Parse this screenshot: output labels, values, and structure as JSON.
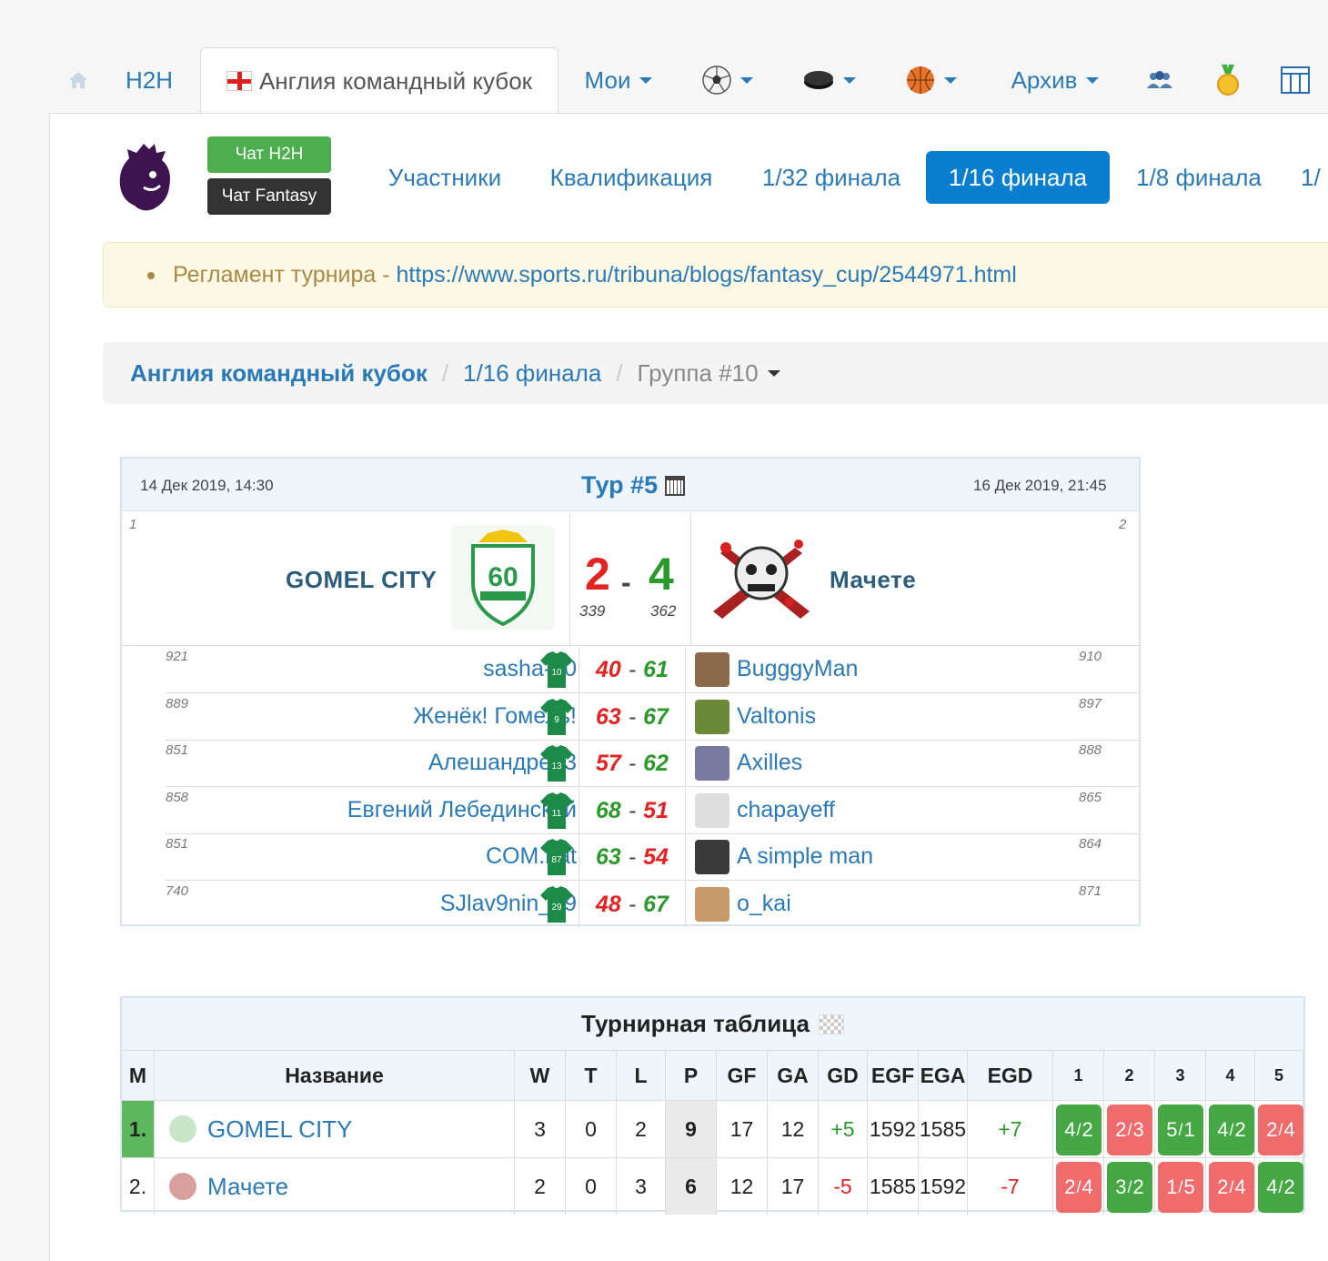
{
  "tabs": {
    "home": "",
    "h2h": "H2H",
    "active": "Англия командный кубок",
    "mine": "Мои",
    "archive": "Архив"
  },
  "chat": {
    "h2h": "Чат H2H",
    "fantasy": "Чат Fantasy"
  },
  "subnav": [
    "Участники",
    "Квалификация",
    "1/32 финала",
    "1/16 финала",
    "1/8 финала",
    "1/"
  ],
  "subnav_active_index": 3,
  "alert": {
    "prefix": "Регламент турнира - ",
    "link": "https://www.sports.ru/tribuna/blogs/fantasy_cup/2544971.html"
  },
  "breadcrumb": {
    "tournament": "Англия командный кубок",
    "round": "1/16 финала",
    "group": "Группа #10",
    "sep": "/"
  },
  "match": {
    "date_start": "14 Дек 2019, 14:30",
    "tour": "Тур #5",
    "date_end": "16 Дек 2019, 21:45",
    "home": {
      "seed": "1",
      "name": "GOMEL CITY",
      "goals": "2",
      "points": "339"
    },
    "away": {
      "seed": "2",
      "name": "Мачете",
      "goals": "4",
      "points": "362"
    },
    "dash": "-",
    "players": [
      {
        "left_rank": "921",
        "left_name": "sasha-10",
        "shirt": "10",
        "ls": "40",
        "rs": "61",
        "right_name": "BugggyMan",
        "right_rank": "910"
      },
      {
        "left_rank": "889",
        "left_name": "Женёк! Гомель!",
        "shirt": "9",
        "ls": "63",
        "rs": "67",
        "right_name": "Valtonis",
        "right_rank": "897"
      },
      {
        "left_rank": "851",
        "left_name": "Алешандре13",
        "shirt": "13",
        "ls": "57",
        "rs": "62",
        "right_name": "Axilles",
        "right_rank": "888"
      },
      {
        "left_rank": "858",
        "left_name": "Евгений Лебединский",
        "shirt": "11",
        "ls": "68",
        "rs": "51",
        "right_name": "chapayeff",
        "right_rank": "865"
      },
      {
        "left_rank": "851",
        "left_name": "COM.bat",
        "shirt": "87",
        "ls": "63",
        "rs": "54",
        "right_name": "A simple man",
        "right_rank": "864"
      },
      {
        "left_rank": "740",
        "left_name": "SJlav9nin_29",
        "shirt": "29",
        "ls": "48",
        "rs": "67",
        "right_name": "o_kai",
        "right_rank": "871"
      }
    ]
  },
  "standings": {
    "title": "Турнирная таблица",
    "headers": [
      "М",
      "Название",
      "W",
      "T",
      "L",
      "P",
      "GF",
      "GA",
      "GD",
      "EGF",
      "EGA",
      "EGD",
      "1",
      "2",
      "3",
      "4",
      "5"
    ],
    "rows": [
      {
        "place": "1.",
        "name": "GOMEL CITY",
        "w": "3",
        "t": "0",
        "l": "2",
        "p": "9",
        "gf": "17",
        "ga": "12",
        "gd": "+5",
        "egf": "1592",
        "ega": "1585",
        "egd": "+7",
        "results": [
          {
            "s": "4",
            "c": "2",
            "win": true
          },
          {
            "s": "2",
            "c": "3",
            "win": false
          },
          {
            "s": "5",
            "c": "1",
            "win": true
          },
          {
            "s": "4",
            "c": "2",
            "win": true
          },
          {
            "s": "2",
            "c": "4",
            "win": false
          }
        ]
      },
      {
        "place": "2.",
        "name": "Мачете",
        "w": "2",
        "t": "0",
        "l": "3",
        "p": "6",
        "gf": "12",
        "ga": "17",
        "gd": "-5",
        "egf": "1585",
        "ega": "1592",
        "egd": "-7",
        "results": [
          {
            "s": "2",
            "c": "4",
            "win": false
          },
          {
            "s": "3",
            "c": "2",
            "win": true
          },
          {
            "s": "1",
            "c": "5",
            "win": false
          },
          {
            "s": "2",
            "c": "4",
            "win": false
          },
          {
            "s": "4",
            "c": "2",
            "win": true
          }
        ]
      }
    ]
  },
  "colors": {
    "link": "#2a7ab8",
    "win": "#2a9a2a",
    "loss": "#e52222",
    "accent": "#0a7fd0"
  }
}
